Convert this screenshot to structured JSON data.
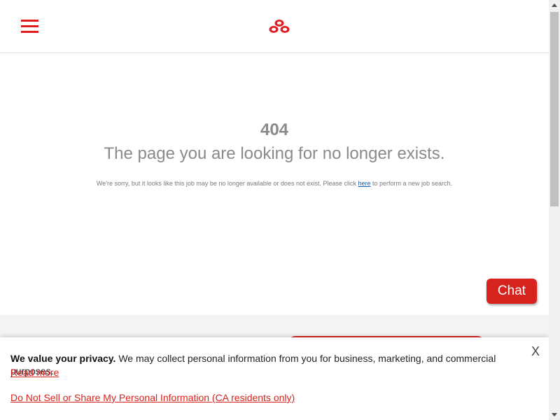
{
  "header": {
    "menu_icon": "hamburger-menu-icon",
    "logo_icon": "three-ovals-logo"
  },
  "error": {
    "code": "404",
    "title": "The page you are looking for no longer exists.",
    "message_prefix": "We're sorry, but it looks like this job may be no longer available or does not exist. Please click ",
    "link_text": "here",
    "message_suffix": " to perform a new job search."
  },
  "chat": {
    "label": "Chat"
  },
  "privacy": {
    "heading": "We value your privacy.",
    "body": " We may collect personal information from you for business, marketing, and commercial purposes.",
    "read_more": "Read more",
    "dns_link": "Do Not Sell or Share My Personal Information (CA residents only)",
    "close_label": "X"
  },
  "colors": {
    "brand_red": "#d6231d",
    "text_gray": "#8a8a8a",
    "link_blue": "#1a5fb4"
  }
}
